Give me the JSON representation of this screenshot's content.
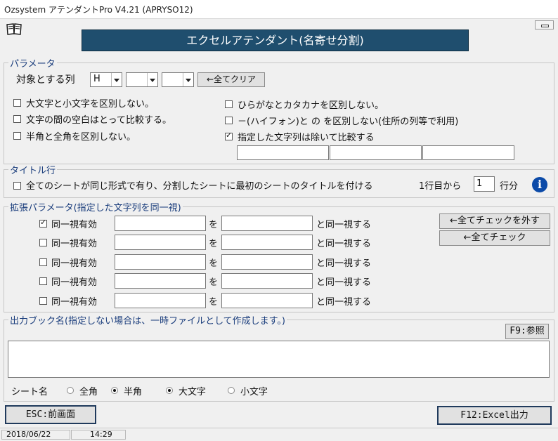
{
  "window": {
    "title": "Ozsystem アテンダントPro V4.21 (APRYSO12)"
  },
  "banner": "エクセルアテンダント(名寄せ分割)",
  "params": {
    "legend": "パラメータ",
    "target_label": "対象とする列",
    "col1": "H",
    "col2": "",
    "col3": "",
    "clear_btn": "←全てクリア",
    "opt_case": "大文字と小文字を区別しない。",
    "opt_space": "文字の間の空白はとって比較する。",
    "opt_width": "半角と全角を区別しない。",
    "opt_kana": "ひらがなとカタカナを区別しない。",
    "opt_hyphen": "－(ハイフォン)と の を区別しない(住所の列等で利用)",
    "opt_exclude": "指定した文字列は除いて比較する",
    "exclude_vals": [
      "",
      "",
      ""
    ]
  },
  "title_row": {
    "legend": "タイトル行",
    "check_label": "全てのシートが同じ形式で有り、分割したシートに最初のシートのタイトルを付ける",
    "from_label": "1行目から",
    "rows_value": "1",
    "rows_unit": "行分",
    "info_icon": "i"
  },
  "extended": {
    "legend": "拡張パラメータ(指定した文字列を同一視)",
    "rows": [
      {
        "label": "同一視有効",
        "checked": true,
        "a": "",
        "mid": "を",
        "b": "",
        "tail": "と同一視する"
      },
      {
        "label": "同一視有効",
        "checked": false,
        "a": "",
        "mid": "を",
        "b": "",
        "tail": "と同一視する"
      },
      {
        "label": "同一視有効",
        "checked": false,
        "a": "",
        "mid": "を",
        "b": "",
        "tail": "と同一視する"
      },
      {
        "label": "同一視有効",
        "checked": false,
        "a": "",
        "mid": "を",
        "b": "",
        "tail": "と同一視する"
      },
      {
        "label": "同一視有効",
        "checked": false,
        "a": "",
        "mid": "を",
        "b": "",
        "tail": "と同一視する"
      }
    ],
    "uncheck_all_btn": "←全てチェックを外す",
    "check_all_btn": "←全てチェック"
  },
  "output": {
    "legend": "出力ブック名(指定しない場合は、一時ファイルとして作成します。)",
    "browse_btn": "F9:参照",
    "book_name": "",
    "sheet_label": "シート名",
    "opt_zenkaku": "全角",
    "opt_hankaku": "半角",
    "opt_upper": "大文字",
    "opt_lower": "小文字"
  },
  "footer": {
    "back_btn": "ESC:前画面",
    "excel_btn": "F12:Excel出力"
  },
  "status": {
    "date": "2018/06/22",
    "time": "14:29"
  }
}
